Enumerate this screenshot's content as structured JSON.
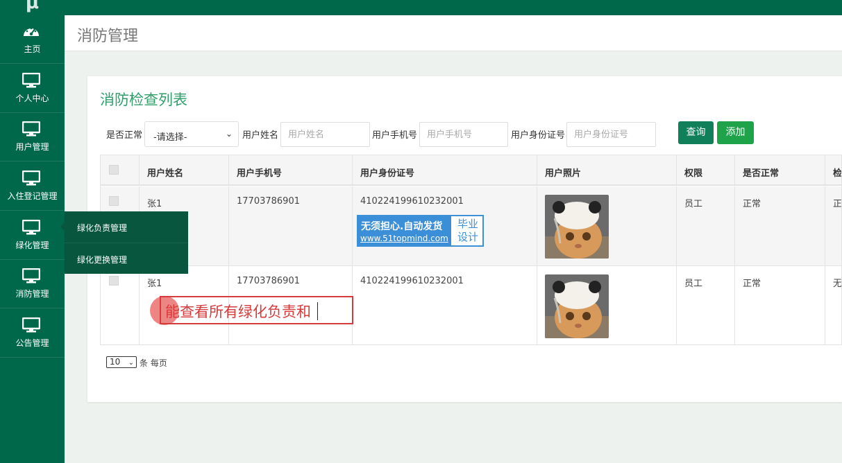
{
  "app": {
    "logo_glyph": "μ"
  },
  "sidebar": {
    "items": [
      {
        "label": "主页",
        "icon": "dashboard-icon"
      },
      {
        "label": "个人中心",
        "icon": "monitor-icon"
      },
      {
        "label": "用户管理",
        "icon": "monitor-icon"
      },
      {
        "label": "入住登记管理",
        "icon": "monitor-icon"
      },
      {
        "label": "绿化管理",
        "icon": "monitor-icon"
      },
      {
        "label": "消防管理",
        "icon": "monitor-icon"
      },
      {
        "label": "公告管理",
        "icon": "monitor-icon"
      }
    ],
    "submenu": [
      {
        "label": "绿化负责管理"
      },
      {
        "label": "绿化更换管理"
      }
    ]
  },
  "header": {
    "title": "消防管理"
  },
  "card": {
    "title": "消防检查列表"
  },
  "filters": {
    "normal_label": "是否正常",
    "normal_select": "-请选择-",
    "name_label": "用户姓名",
    "name_placeholder": "用户姓名",
    "phone_label": "用户手机号",
    "phone_placeholder": "用户手机号",
    "id_label": "用户身份证号",
    "id_placeholder": "用户身份证号",
    "query_button": "查询",
    "add_button": "添加"
  },
  "table": {
    "headers": [
      "用户姓名",
      "用户手机号",
      "用户身份证号",
      "用户照片",
      "权限",
      "是否正常",
      "检"
    ],
    "rows": [
      {
        "name": "张1",
        "phone": "17703786901",
        "id_number": "410224199610232001",
        "role": "员工",
        "normal": "正常",
        "last": "正"
      },
      {
        "name": "张1",
        "phone": "17703786901",
        "id_number": "410224199610232001",
        "role": "员工",
        "normal": "正常",
        "last": "无"
      }
    ]
  },
  "pager": {
    "page_size": "10",
    "per_page_text": "条 每页"
  },
  "watermark": {
    "line1": "无须担心.自动发货",
    "line2": "www.51topmind.com",
    "right": "毕业设计"
  },
  "annotation": {
    "text": "能查看所有绿化负责和"
  },
  "colors": {
    "sidebar": "#00684a",
    "accent": "#2f9e6a",
    "query": "#11805a",
    "add": "#1fa34a",
    "annotation": "#d63a3a"
  }
}
